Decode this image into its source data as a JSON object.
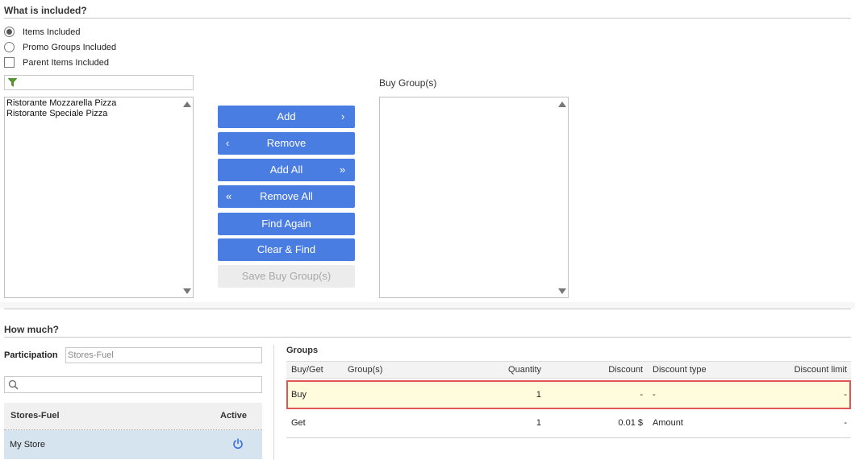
{
  "included": {
    "title": "What is included?",
    "options": [
      {
        "label": "Items Included",
        "type": "radio",
        "checked": true
      },
      {
        "label": "Promo Groups Included",
        "type": "radio",
        "checked": false
      },
      {
        "label": "Parent Items Included",
        "type": "checkbox",
        "checked": false
      }
    ],
    "filter_icon": "filter-icon",
    "available_items": [
      "Ristorante Mozzarella Pizza",
      "Ristorante Speciale Pizza"
    ],
    "buy_group_label": "Buy Group(s)",
    "buttons": {
      "add": "Add",
      "remove": "Remove",
      "add_all": "Add All",
      "remove_all": "Remove All",
      "find_again": "Find Again",
      "clear_find": "Clear & Find",
      "save_buy_groups": "Save Buy Group(s)"
    }
  },
  "how_much": {
    "title": "How much?",
    "participation_label": "Participation",
    "participation_value": "Stores-Fuel",
    "search_icon": "search-icon",
    "stores_panel": {
      "col_name": "Stores-Fuel",
      "col_active": "Active",
      "rows": [
        {
          "name": "My Store",
          "active_icon": "power-icon"
        }
      ]
    },
    "groups": {
      "title": "Groups",
      "columns": {
        "buy_get": "Buy/Get",
        "groups": "Group(s)",
        "quantity": "Quantity",
        "discount": "Discount",
        "discount_type": "Discount type",
        "discount_limit": "Discount limit"
      },
      "rows": [
        {
          "buy_get": "Buy",
          "groups": "",
          "quantity": "1",
          "discount": "-",
          "discount_type": "-",
          "discount_limit": "-",
          "highlighted": true
        },
        {
          "buy_get": "Get",
          "groups": "",
          "quantity": "1",
          "discount": "0.01 $",
          "discount_type": "Amount",
          "discount_limit": "-",
          "highlighted": false
        }
      ]
    }
  },
  "colors": {
    "button": "#4a7de2",
    "highlight_row": "#fffbdc",
    "highlight_border": "#e05555",
    "store_row": "#d6e4ef",
    "power_icon": "#3b6fd8"
  }
}
